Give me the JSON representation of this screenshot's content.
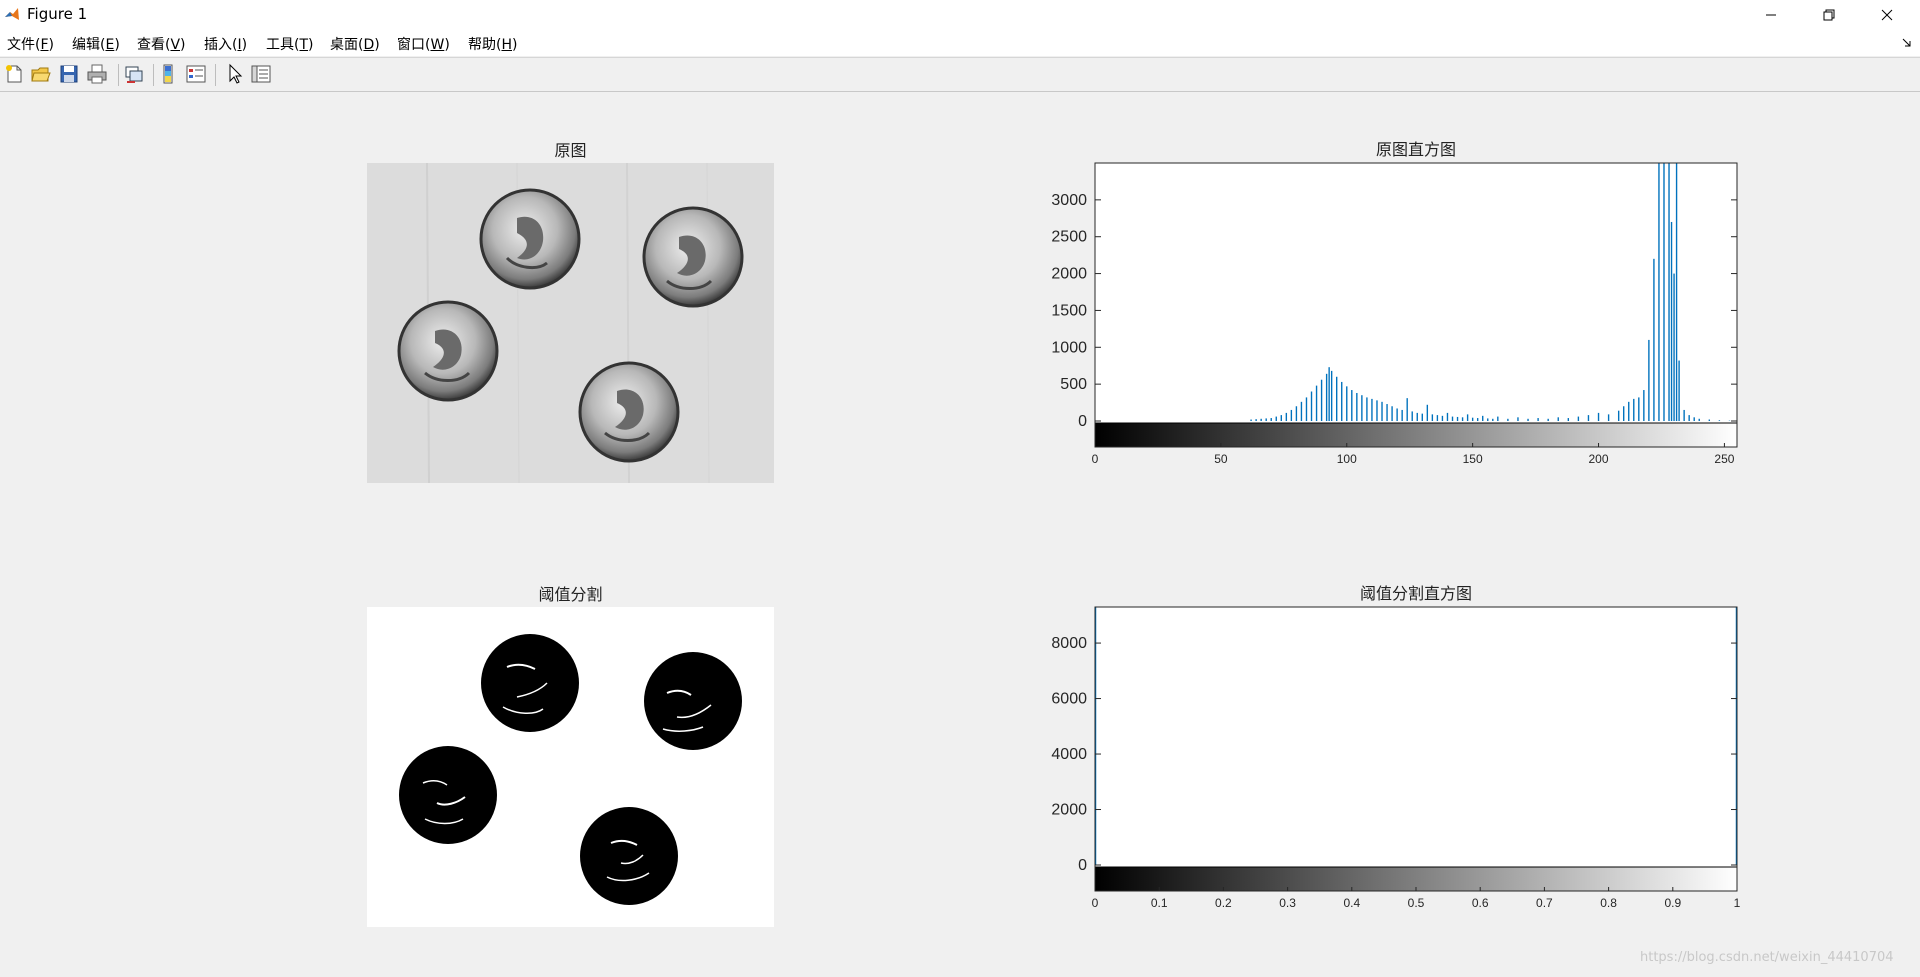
{
  "window": {
    "title": "Figure 1",
    "controls": [
      "minimize",
      "restore",
      "close"
    ]
  },
  "menubar": {
    "items": [
      {
        "label": "文件(",
        "acc": "F",
        "tail": ")"
      },
      {
        "label": "编辑(",
        "acc": "E",
        "tail": ")"
      },
      {
        "label": "查看(",
        "acc": "V",
        "tail": ")"
      },
      {
        "label": "插入(",
        "acc": "I",
        "tail": ")"
      },
      {
        "label": "工具(",
        "acc": "T",
        "tail": ")"
      },
      {
        "label": "桌面(",
        "acc": "D",
        "tail": ")"
      },
      {
        "label": "窗口(",
        "acc": "W",
        "tail": ")"
      },
      {
        "label": "帮助(",
        "acc": "H",
        "tail": ")"
      }
    ]
  },
  "toolbar": {
    "icons": [
      "new-figure-icon",
      "open-file-icon",
      "save-icon",
      "print-icon",
      "link-axes-icon",
      "colorbar-icon",
      "legend-icon",
      "pointer-icon",
      "property-inspector-icon"
    ]
  },
  "panels": {
    "original_image": {
      "title": "原图"
    },
    "threshold_image": {
      "title": "阈值分割"
    }
  },
  "chart_data": [
    {
      "type": "bar",
      "title": "原图直方图",
      "xlabel": "",
      "ylabel": "",
      "xlim": [
        0,
        255
      ],
      "ylim": [
        0,
        3500
      ],
      "yticks": [
        0,
        500,
        1000,
        1500,
        2000,
        2500,
        3000
      ],
      "xticks": [
        0,
        50,
        100,
        150,
        200,
        250
      ],
      "color": "#0072bd",
      "colorbar": "gray",
      "points": [
        [
          62,
          20
        ],
        [
          64,
          25
        ],
        [
          66,
          30
        ],
        [
          68,
          35
        ],
        [
          70,
          40
        ],
        [
          72,
          60
        ],
        [
          74,
          80
        ],
        [
          76,
          110
        ],
        [
          78,
          150
        ],
        [
          80,
          200
        ],
        [
          82,
          260
        ],
        [
          84,
          320
        ],
        [
          86,
          400
        ],
        [
          88,
          480
        ],
        [
          90,
          560
        ],
        [
          92,
          640
        ],
        [
          93,
          730
        ],
        [
          94,
          680
        ],
        [
          96,
          600
        ],
        [
          98,
          530
        ],
        [
          100,
          470
        ],
        [
          102,
          420
        ],
        [
          104,
          380
        ],
        [
          106,
          350
        ],
        [
          108,
          320
        ],
        [
          110,
          300
        ],
        [
          112,
          280
        ],
        [
          114,
          260
        ],
        [
          116,
          230
        ],
        [
          118,
          200
        ],
        [
          120,
          170
        ],
        [
          122,
          150
        ],
        [
          124,
          310
        ],
        [
          126,
          130
        ],
        [
          128,
          110
        ],
        [
          130,
          100
        ],
        [
          132,
          220
        ],
        [
          134,
          90
        ],
        [
          136,
          80
        ],
        [
          138,
          70
        ],
        [
          140,
          110
        ],
        [
          142,
          60
        ],
        [
          144,
          55
        ],
        [
          146,
          50
        ],
        [
          148,
          90
        ],
        [
          150,
          45
        ],
        [
          152,
          40
        ],
        [
          154,
          70
        ],
        [
          156,
          35
        ],
        [
          158,
          30
        ],
        [
          160,
          60
        ],
        [
          164,
          30
        ],
        [
          168,
          50
        ],
        [
          172,
          30
        ],
        [
          176,
          40
        ],
        [
          180,
          30
        ],
        [
          184,
          50
        ],
        [
          188,
          40
        ],
        [
          192,
          60
        ],
        [
          196,
          80
        ],
        [
          200,
          110
        ],
        [
          204,
          90
        ],
        [
          208,
          140
        ],
        [
          210,
          200
        ],
        [
          212,
          260
        ],
        [
          214,
          300
        ],
        [
          216,
          320
        ],
        [
          218,
          420
        ],
        [
          220,
          1100
        ],
        [
          222,
          2200
        ],
        [
          224,
          3500
        ],
        [
          226,
          3500
        ],
        [
          228,
          3500
        ],
        [
          229,
          2700
        ],
        [
          230,
          2000
        ],
        [
          231,
          3500
        ],
        [
          232,
          820
        ],
        [
          234,
          150
        ],
        [
          236,
          80
        ],
        [
          238,
          50
        ],
        [
          240,
          30
        ],
        [
          244,
          20
        ],
        [
          248,
          10
        ],
        [
          252,
          5
        ]
      ]
    },
    {
      "type": "bar",
      "title": "阈值分割直方图",
      "xlabel": "",
      "ylabel": "",
      "xlim": [
        0,
        1
      ],
      "ylim": [
        0,
        9300
      ],
      "yticks": [
        0,
        2000,
        4000,
        6000,
        8000
      ],
      "xticks": [
        "0",
        "0.1",
        "0.2",
        "0.3",
        "0.4",
        "0.5",
        "0.6",
        "0.7",
        "0.8",
        "0.9",
        "1"
      ],
      "color": "#0072bd",
      "colorbar": "gray",
      "points": []
    }
  ],
  "watermark": "https://blog.csdn.net/weixin_44410704"
}
